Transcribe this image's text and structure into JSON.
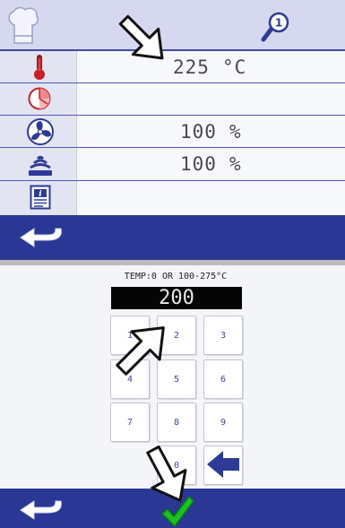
{
  "oven_screen": {
    "header": {
      "hat_icon": "chef-hat-icon",
      "search_icon": "magnifier-icon",
      "search_badge": "1"
    },
    "rows": [
      {
        "icon": "thermometer-icon",
        "value": "225",
        "unit": "°C"
      },
      {
        "icon": "timer-icon",
        "value": "",
        "unit": ""
      },
      {
        "icon": "fan-icon",
        "value": "100",
        "unit": "%"
      },
      {
        "icon": "humidity-icon",
        "value": "100",
        "unit": "%"
      },
      {
        "icon": "info-icon",
        "value": "",
        "unit": ""
      }
    ],
    "footer": {
      "back_icon": "return-arrow-icon"
    }
  },
  "keypad_screen": {
    "range_label": "TEMP:0 OR 100-275°C",
    "display_value": "200",
    "keys": [
      "1",
      "2",
      "3",
      "4",
      "5",
      "6",
      "7",
      "8",
      "9",
      "0"
    ],
    "backspace_icon": "backspace-arrow-icon",
    "footer": {
      "back_icon": "return-arrow-icon",
      "confirm_icon": "checkmark-icon"
    }
  },
  "colors": {
    "header_bg": "#d5d8ee",
    "footer_bg": "#2a3794",
    "row_line": "#4d59b1",
    "confirm_green": "#19c21e"
  }
}
